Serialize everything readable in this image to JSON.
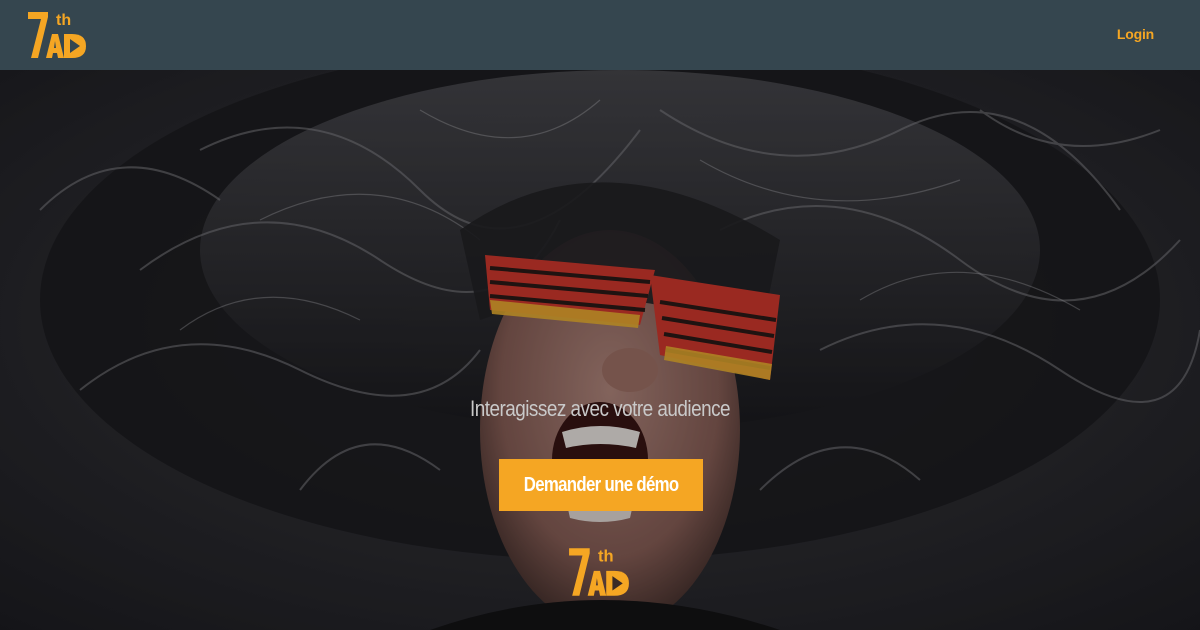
{
  "header": {
    "logo": {
      "icon": "7thad-logo-icon",
      "text_main": "7",
      "text_sup": "th",
      "text_sub": "AD"
    },
    "login_label": "Login"
  },
  "hero": {
    "background": "photo-man-wild-hair-shutter-shades",
    "tagline": "Interagissez avec votre audience",
    "cta_label": "Demander une démo",
    "logo": {
      "icon": "7thad-logo-icon",
      "text_main": "7",
      "text_sup": "th",
      "text_sub": "AD"
    }
  },
  "colors": {
    "header_bg": "#35464f",
    "accent": "#f5a623",
    "button_text": "#ffffff",
    "tagline_text": "#c9c9c9"
  }
}
